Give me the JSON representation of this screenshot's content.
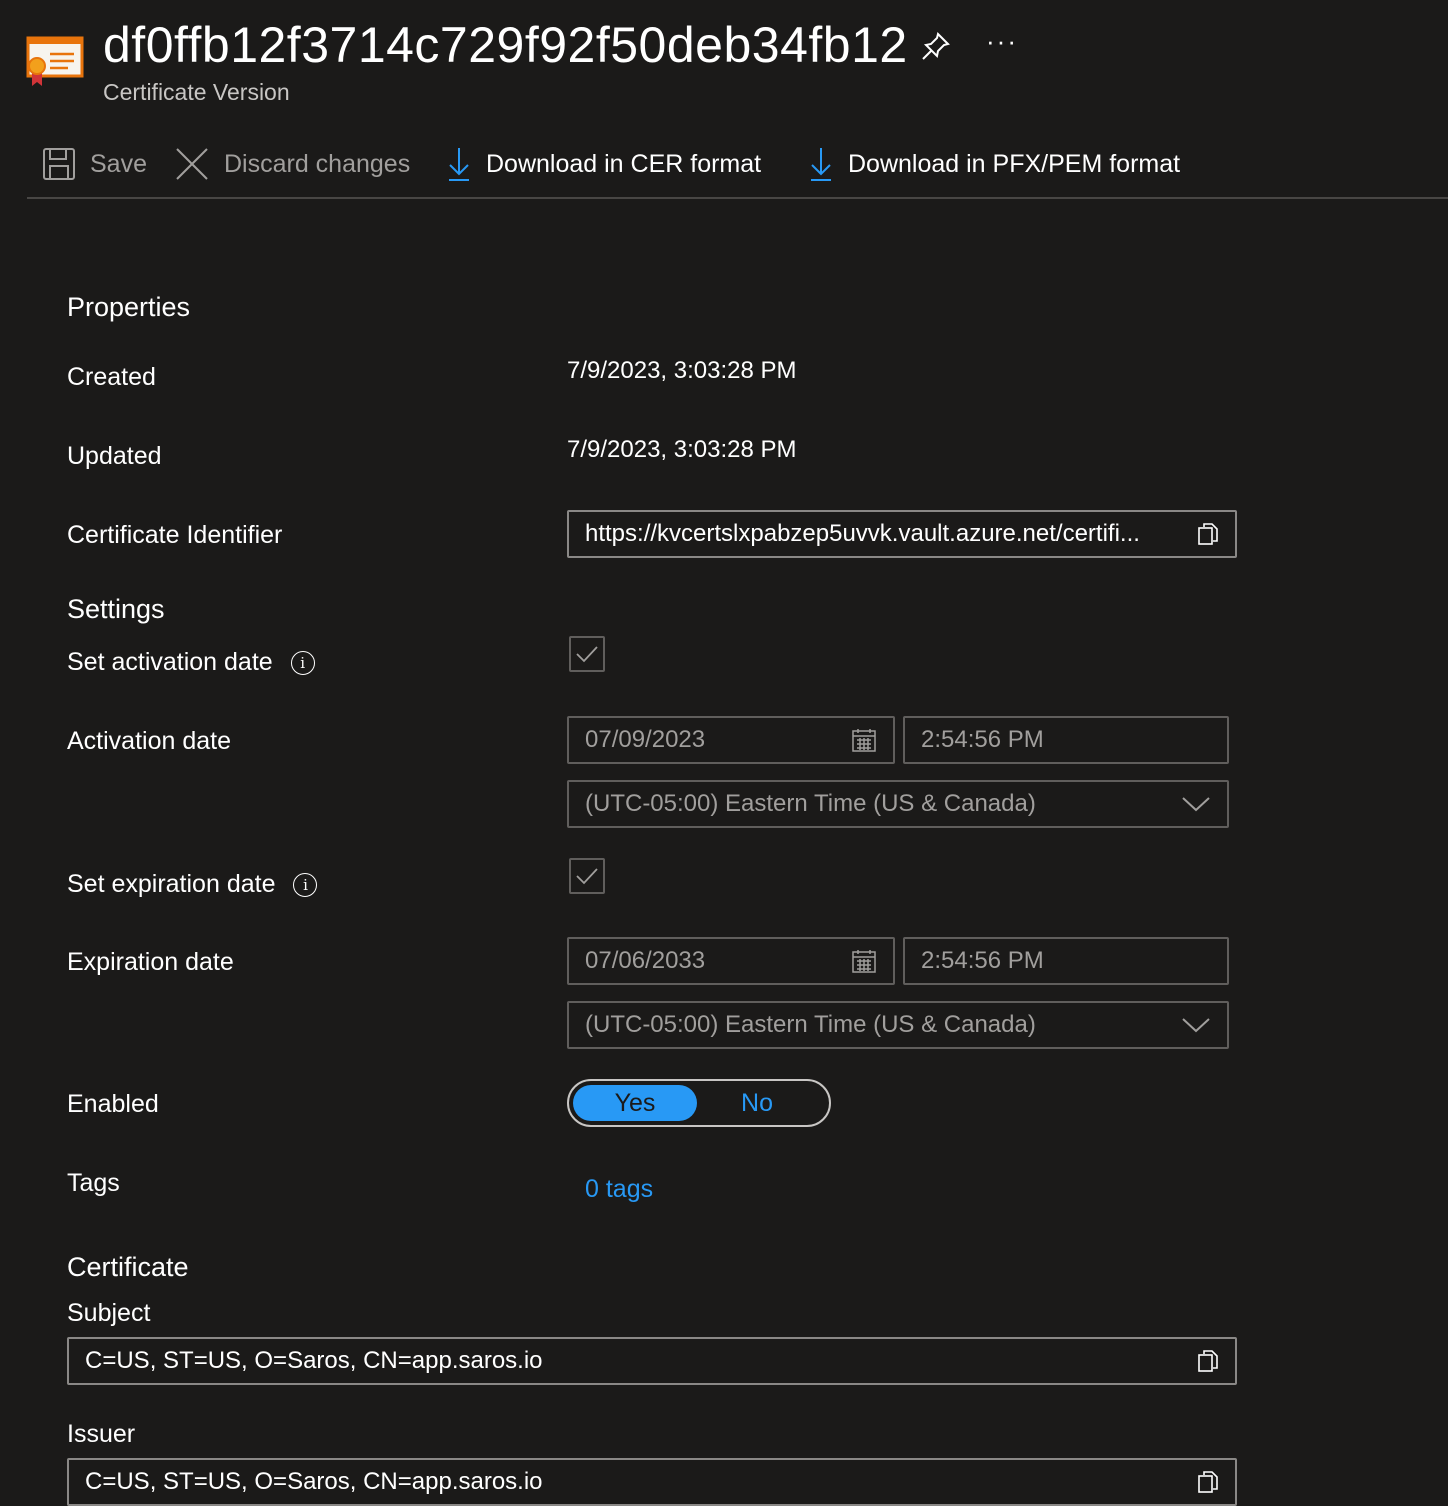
{
  "header": {
    "title": "df0ffb12f3714c729f92f50deb34fb12",
    "subtitle": "Certificate Version",
    "icons": [
      "certificate-icon",
      "pin-icon",
      "more-icon"
    ],
    "more_label": "···"
  },
  "toolbar": {
    "save_label": "Save",
    "discard_label": "Discard changes",
    "download_cer_label": "Download in CER format",
    "download_pfx_label": "Download in PFX/PEM format"
  },
  "properties": {
    "heading": "Properties",
    "created_label": "Created",
    "created_value": "7/9/2023, 3:03:28 PM",
    "updated_label": "Updated",
    "updated_value": "7/9/2023, 3:03:28 PM",
    "identifier_label": "Certificate Identifier",
    "identifier_value": "https://kvcertslxpabzep5uvvk.vault.azure.net/certifi..."
  },
  "settings": {
    "heading": "Settings",
    "set_activation_label": "Set activation date",
    "set_activation_checked": true,
    "activation_label": "Activation date",
    "activation_date": "07/09/2023",
    "activation_time": "2:54:56 PM",
    "activation_timezone": "(UTC-05:00) Eastern Time (US & Canada)",
    "set_expiration_label": "Set expiration date",
    "set_expiration_checked": true,
    "expiration_label": "Expiration date",
    "expiration_date": "07/06/2033",
    "expiration_time": "2:54:56 PM",
    "expiration_timezone": "(UTC-05:00) Eastern Time (US & Canada)",
    "enabled_label": "Enabled",
    "enabled_yes": "Yes",
    "enabled_no": "No",
    "enabled_selected": "Yes",
    "tags_label": "Tags",
    "tags_value": "0 tags"
  },
  "certificate": {
    "heading": "Certificate",
    "subject_label": "Subject",
    "subject_value": "C=US, ST=US, O=Saros, CN=app.saros.io",
    "issuer_label": "Issuer",
    "issuer_value": "C=US, ST=US, O=Saros, CN=app.saros.io"
  },
  "colors": {
    "background": "#1b1a19",
    "accent": "#2899f5",
    "border": "#8a8886",
    "disabled_text": "#a19f9d"
  }
}
